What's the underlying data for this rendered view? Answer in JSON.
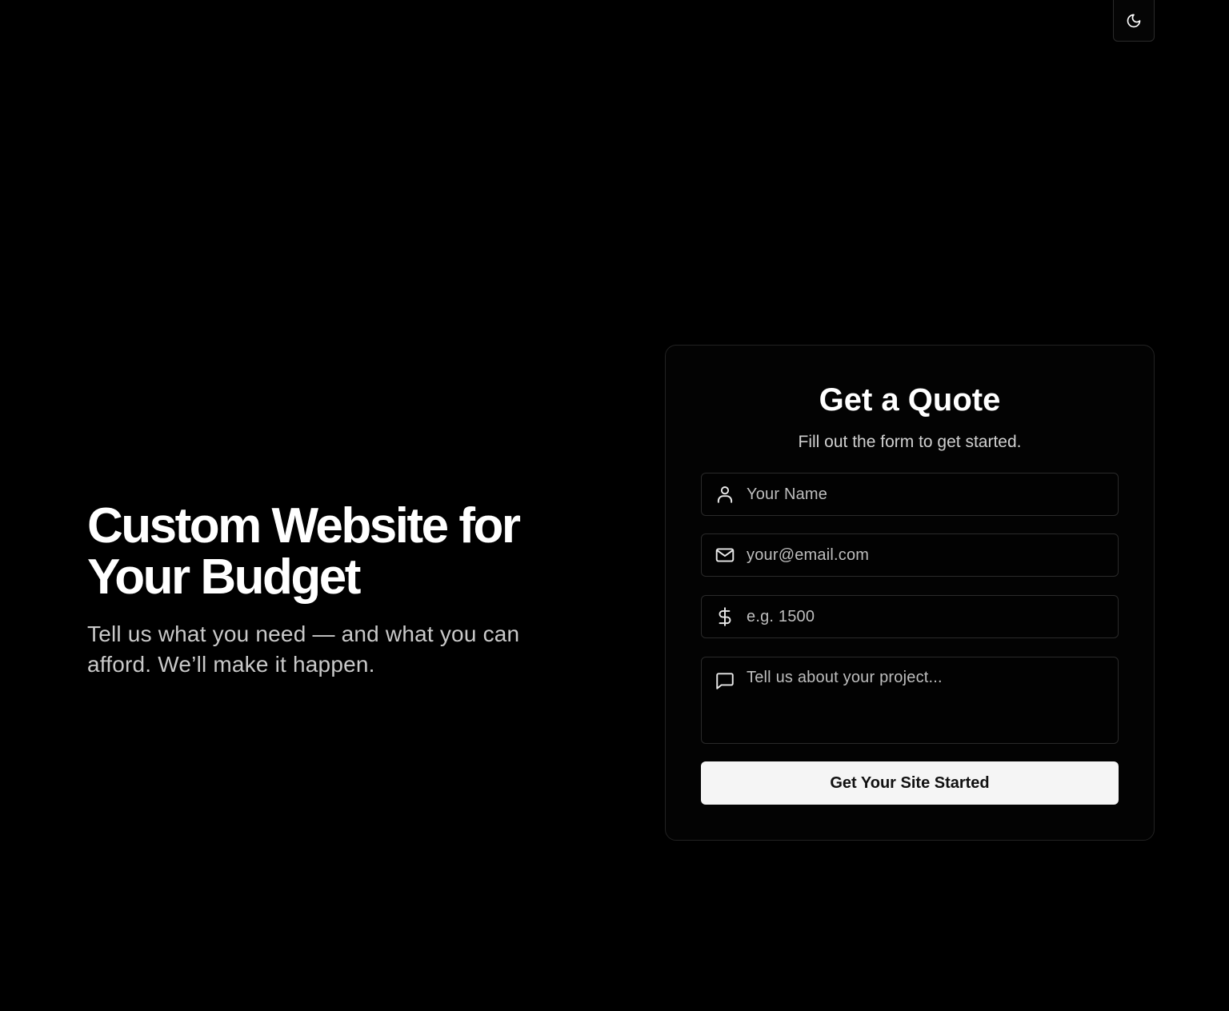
{
  "header": {
    "theme_toggle_icon": "moon-icon"
  },
  "hero": {
    "title": "Custom Website for Your Budget",
    "subtitle": "Tell us what you need — and what you can afford. We’ll make it happen."
  },
  "quote_form": {
    "title": "Get a Quote",
    "subtitle": "Fill out the form to get started.",
    "fields": [
      {
        "icon": "user-icon",
        "placeholder": "Your Name",
        "value": ""
      },
      {
        "icon": "mail-icon",
        "placeholder": "your@email.com",
        "value": ""
      },
      {
        "icon": "dollar-icon",
        "placeholder": "e.g. 1500",
        "value": ""
      },
      {
        "icon": "message-icon",
        "placeholder": "Tell us about your project...",
        "value": ""
      }
    ],
    "submit_label": "Get Your Site Started"
  },
  "colors": {
    "background": "#000000",
    "card_border": "#222222",
    "button_bg": "#f5f5f5",
    "button_text": "#111111",
    "muted_text": "#c9c9c9"
  }
}
